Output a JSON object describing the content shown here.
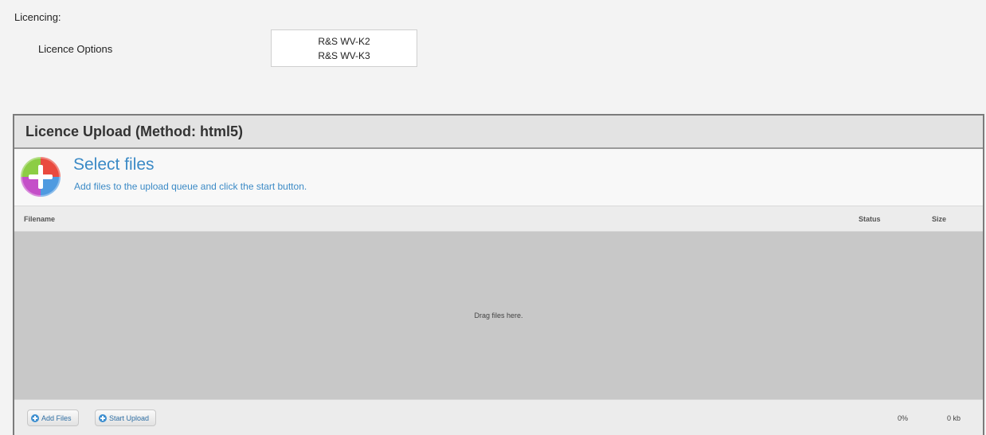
{
  "licencing": {
    "title": "Licencing:",
    "options_label": "Licence Options",
    "options": [
      "R&S WV-K2",
      "R&S WV-K3"
    ]
  },
  "upload": {
    "header": "Licence Upload (Method: html5)",
    "select_title": "Select files",
    "select_subtitle": "Add files to the upload queue and click the start button.",
    "columns": {
      "filename": "Filename",
      "status": "Status",
      "size": "Size"
    },
    "drop_text": "Drag files here.",
    "add_files_label": "Add Files",
    "start_upload_label": "Start Upload",
    "total_percent": "0%",
    "total_size": "0 kb"
  },
  "icons": {
    "select_files": "add-circle-icon",
    "add_files": "plus-circle-icon",
    "start_upload": "plus-circle-icon"
  },
  "colors": {
    "link_blue": "#3b8ac6",
    "panel_border": "#7b7b7b",
    "dropzone_bg": "#c8c8c8"
  }
}
